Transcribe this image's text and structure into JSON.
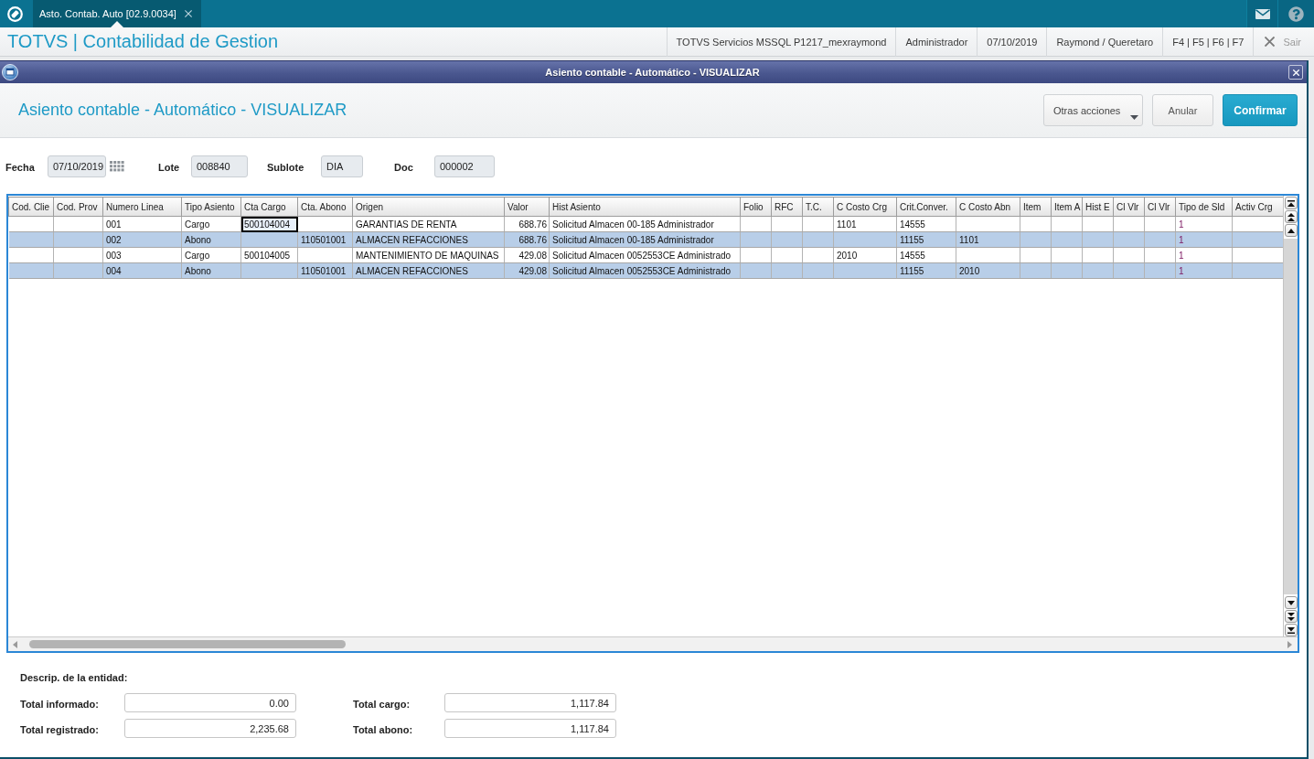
{
  "top_bar": {
    "tabs": [
      {
        "label": "Asto. Contab. Auto [02.9.0034]",
        "selected": true
      }
    ]
  },
  "header": {
    "title": "TOTVS | Contabilidad de Gestion",
    "info": [
      "TOTVS Servicios MSSQL P1217_mexraymond",
      "Administrador",
      "07/10/2019",
      "Raymond / Queretaro",
      "F4 | F5 | F6 | F7"
    ],
    "exit_label": "Sair"
  },
  "dialog": {
    "title": "Asiento contable - Automático - VISUALIZAR",
    "heading": "Asiento contable - Automático - VISUALIZAR",
    "actions": [
      {
        "label": "Otras acciones",
        "kind": "menu"
      },
      {
        "label": "Anular",
        "kind": "secondary"
      },
      {
        "label": "Confirmar",
        "kind": "primary"
      }
    ]
  },
  "fields": [
    {
      "label": "Fecha",
      "value": "07/10/2019",
      "kind": "date"
    },
    {
      "label": "Lote",
      "value": "008840",
      "kind": "text"
    },
    {
      "label": "Sublote",
      "value": "DIA",
      "kind": "text"
    },
    {
      "label": "Doc",
      "value": "000002",
      "kind": "text"
    }
  ],
  "grid": {
    "columns": [
      {
        "label": "Cod. Clie",
        "kind": "text"
      },
      {
        "label": "Cod. Prov",
        "kind": "text"
      },
      {
        "label": "Numero Linea",
        "kind": "text"
      },
      {
        "label": "Tipo Asiento",
        "kind": "text"
      },
      {
        "label": "Cta Cargo",
        "kind": "text"
      },
      {
        "label": "Cta. Abono",
        "kind": "text"
      },
      {
        "label": "Origen",
        "kind": "text"
      },
      {
        "label": "Valor",
        "kind": "number"
      },
      {
        "label": "Hist Asiento",
        "kind": "text"
      },
      {
        "label": "Folio",
        "kind": "text"
      },
      {
        "label": "RFC",
        "kind": "text"
      },
      {
        "label": "T.C.",
        "kind": "text"
      },
      {
        "label": "C Costo Crg",
        "kind": "text"
      },
      {
        "label": "Crit.Conver.",
        "kind": "text"
      },
      {
        "label": "C Costo Abn",
        "kind": "text"
      },
      {
        "label": "Item",
        "kind": "text"
      },
      {
        "label": "Item A",
        "kind": "text"
      },
      {
        "label": "Hist E",
        "kind": "text"
      },
      {
        "label": "Cl Vlr",
        "kind": "text"
      },
      {
        "label": "Cl Vlr",
        "kind": "text"
      },
      {
        "label": "Tipo de Sld",
        "kind": "code"
      },
      {
        "label": "Activ Crg",
        "kind": "text"
      }
    ],
    "rows": [
      {
        "cells": [
          {
            "focused": false
          },
          {
            "focused": false
          },
          {
            "text": "001",
            "focused": false
          },
          {
            "text": "Cargo",
            "focused": false
          },
          {
            "text": "500104004",
            "focused": true
          },
          {
            "focused": false
          },
          {
            "text": "GARANTIAS DE RENTA",
            "focused": false
          },
          {
            "text": "688.76",
            "focused": false
          },
          {
            "text": "Solicitud Almacen 00-185 Administrador",
            "focused": false
          },
          {
            "focused": false
          },
          {
            "focused": false
          },
          {
            "focused": false
          },
          {
            "text": "1101",
            "focused": false
          },
          {
            "text": "14555",
            "focused": false
          },
          {
            "focused": false
          },
          {
            "focused": false
          },
          {
            "focused": false
          },
          {
            "focused": false
          },
          {
            "focused": false
          },
          {
            "focused": false
          },
          {
            "text": "1",
            "focused": false
          },
          {
            "focused": false
          }
        ]
      },
      {
        "cells": [
          {
            "focused": false
          },
          {
            "focused": false
          },
          {
            "text": "002",
            "focused": false
          },
          {
            "text": "Abono",
            "focused": false
          },
          {
            "focused": false
          },
          {
            "text": "110501001",
            "focused": false
          },
          {
            "text": "ALMACEN REFACCIONES",
            "focused": false
          },
          {
            "text": "688.76",
            "focused": false
          },
          {
            "text": "Solicitud Almacen 00-185 Administrador",
            "focused": false
          },
          {
            "focused": false
          },
          {
            "focused": false
          },
          {
            "focused": false
          },
          {
            "focused": false
          },
          {
            "text": "11155",
            "focused": false
          },
          {
            "text": "1101",
            "focused": false
          },
          {
            "focused": false
          },
          {
            "focused": false
          },
          {
            "focused": false
          },
          {
            "focused": false
          },
          {
            "focused": false
          },
          {
            "text": "1",
            "focused": false
          },
          {
            "focused": false
          }
        ]
      },
      {
        "cells": [
          {
            "focused": false
          },
          {
            "focused": false
          },
          {
            "text": "003",
            "focused": false
          },
          {
            "text": "Cargo",
            "focused": false
          },
          {
            "text": "500104005",
            "focused": false
          },
          {
            "focused": false
          },
          {
            "text": "MANTENIMIENTO DE MAQUINAS",
            "focused": false
          },
          {
            "text": "429.08",
            "focused": false
          },
          {
            "text": "Solicitud Almacen 0052553CE Administrado",
            "focused": false
          },
          {
            "focused": false
          },
          {
            "focused": false
          },
          {
            "focused": false
          },
          {
            "text": "2010",
            "focused": false
          },
          {
            "text": "14555",
            "focused": false
          },
          {
            "focused": false
          },
          {
            "focused": false
          },
          {
            "focused": false
          },
          {
            "focused": false
          },
          {
            "focused": false
          },
          {
            "focused": false
          },
          {
            "text": "1",
            "focused": false
          },
          {
            "focused": false
          }
        ]
      },
      {
        "cells": [
          {
            "focused": false
          },
          {
            "focused": false
          },
          {
            "text": "004",
            "focused": false
          },
          {
            "text": "Abono",
            "focused": false
          },
          {
            "focused": false
          },
          {
            "text": "110501001",
            "focused": false
          },
          {
            "text": "ALMACEN REFACCIONES",
            "focused": false
          },
          {
            "text": "429.08",
            "focused": false
          },
          {
            "text": "Solicitud Almacen 0052553CE Administrado",
            "focused": false
          },
          {
            "focused": false
          },
          {
            "focused": false
          },
          {
            "focused": false
          },
          {
            "focused": false
          },
          {
            "text": "11155",
            "focused": false
          },
          {
            "text": "2010",
            "focused": false
          },
          {
            "focused": false
          },
          {
            "focused": false
          },
          {
            "focused": false
          },
          {
            "focused": false
          },
          {
            "focused": false
          },
          {
            "text": "1",
            "focused": false
          },
          {
            "focused": false
          }
        ]
      }
    ]
  },
  "totals": {
    "entity_label": "Descrip. de la entidad:",
    "items": [
      {
        "label": "Total informado:",
        "value": "0.00"
      },
      {
        "label": "Total cargo:",
        "value": "1,117.84"
      },
      {
        "label": "Total registrado:",
        "value": "2,235.68"
      },
      {
        "label": "Total abono:",
        "value": "1,117.84"
      }
    ]
  }
}
